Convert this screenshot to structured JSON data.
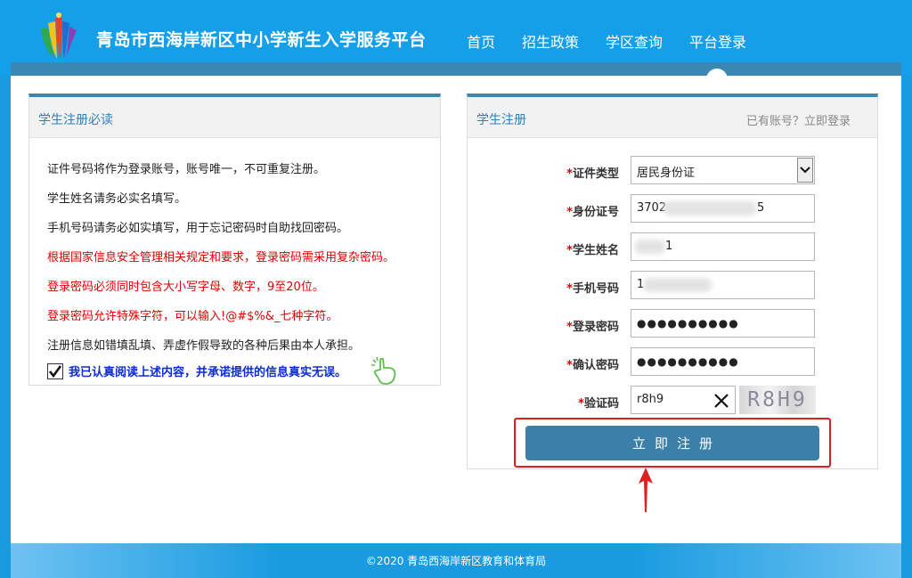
{
  "header": {
    "site_title": "青岛市西海岸新区中小学新生入学服务平台",
    "nav": [
      {
        "label": "首页"
      },
      {
        "label": "招生政策"
      },
      {
        "label": "学区查询"
      },
      {
        "label": "平台登录",
        "active": true
      }
    ]
  },
  "notice_panel": {
    "title": "学生注册必读",
    "lines": [
      {
        "text": "证件号码将作为登录账号，账号唯一，不可重复注册。",
        "color": "black"
      },
      {
        "text": "学生姓名请务必实名填写。",
        "color": "black"
      },
      {
        "text": "手机号码请务必如实填写，用于忘记密码时自助找回密码。",
        "color": "black"
      },
      {
        "text": "根据国家信息安全管理相关规定和要求，登录密码需采用复杂密码。",
        "color": "red"
      },
      {
        "text": "登录密码必须同时包含大小写字母、数字，9至20位。",
        "color": "red"
      },
      {
        "text": "登录密码允许特殊字符，可以输入!@#$%&_七种字符。",
        "color": "red"
      },
      {
        "text": "注册信息如错填乱填、弄虚作假导致的各种后果由本人承担。",
        "color": "black"
      }
    ],
    "agree_text": "我已认真阅读上述内容，并承诺提供的信息真实无误。",
    "agree_checked": true
  },
  "register_panel": {
    "title": "学生注册",
    "login_link": "已有账号？立即登录",
    "fields": {
      "id_type": {
        "label": "证件类型",
        "value": "居民身份证"
      },
      "id_number": {
        "label": "身份证号",
        "value_start": "3702",
        "value_end": "5"
      },
      "student_name": {
        "label": "学生姓名",
        "value_end": "1"
      },
      "phone": {
        "label": "手机号码",
        "value_start": "1"
      },
      "password": {
        "label": "登录密码",
        "value": "●●●●●●●●●●"
      },
      "confirm_password": {
        "label": "确认密码",
        "value": "●●●●●●●●●●"
      },
      "captcha": {
        "label": "验证码",
        "value": "r8h9",
        "image_text": "R8H9"
      }
    },
    "required_mark": "*",
    "submit_label": "立即注册"
  },
  "footer": {
    "text": "©2020 青岛西海岸新区教育和体育局"
  },
  "colors": {
    "brand_blue": "#149fe8",
    "band_blue": "#3a87b3",
    "button_blue": "#3c7fa8",
    "warning_red": "#e00000",
    "agree_blue": "#0a2bd6"
  }
}
